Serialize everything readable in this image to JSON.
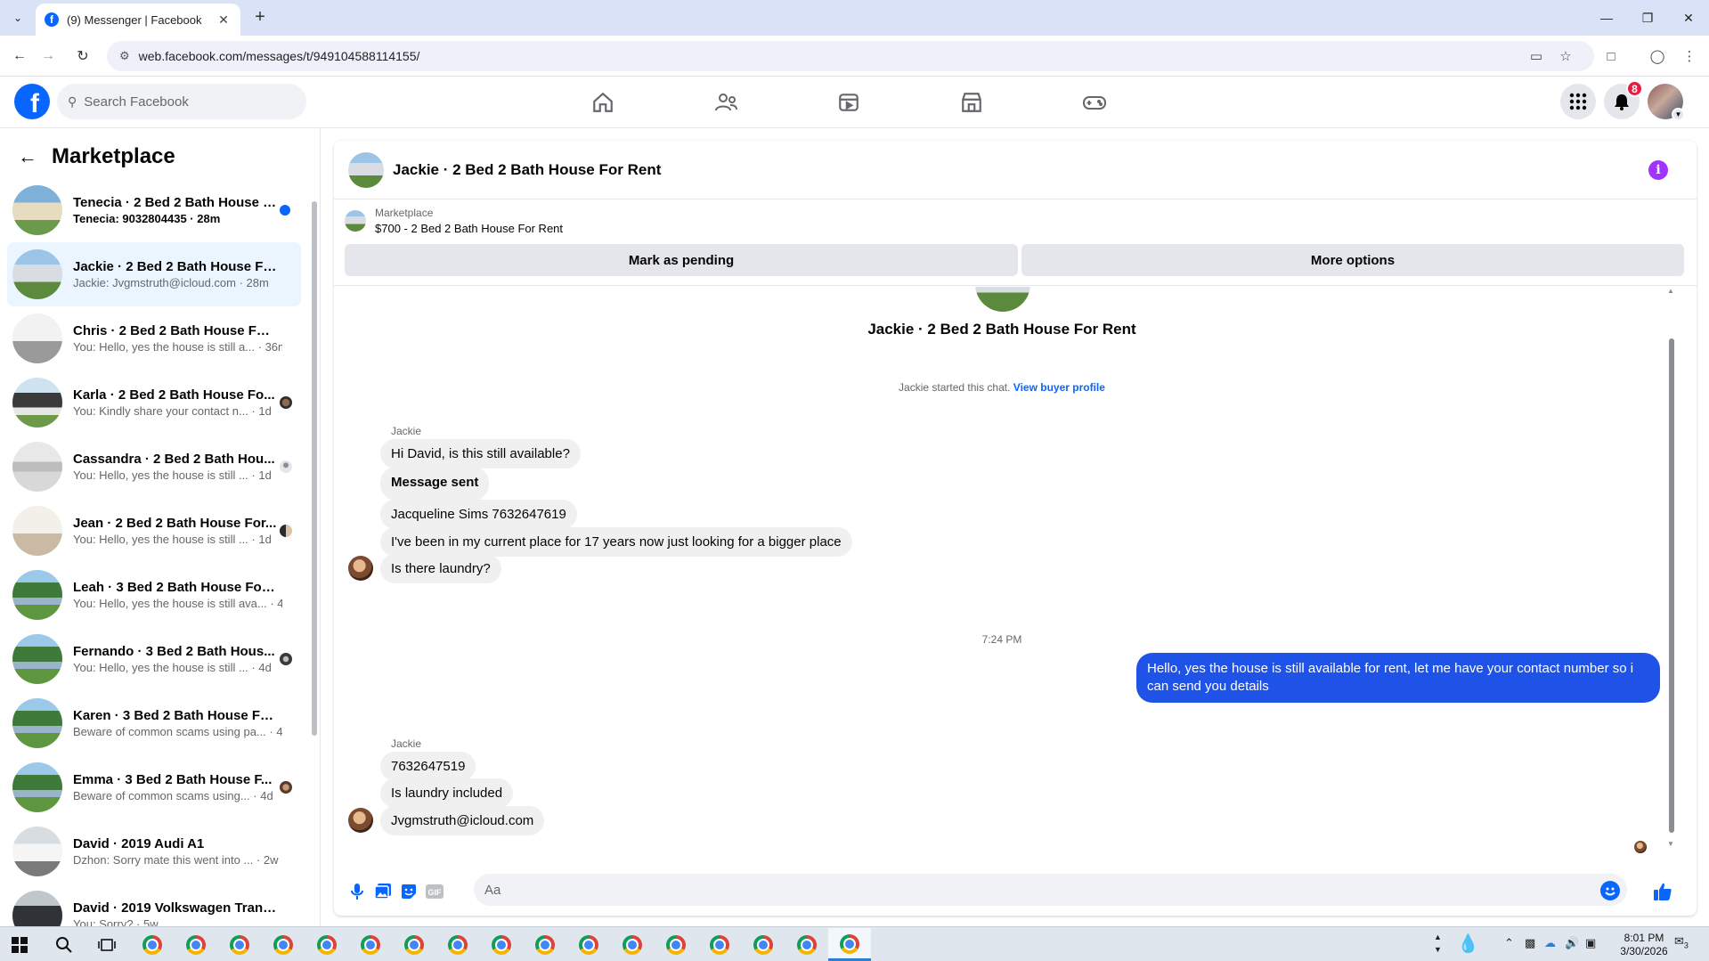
{
  "browser": {
    "tab_title": "(9) Messenger | Facebook",
    "url": "web.facebook.com/messages/t/949104588114155/"
  },
  "fb": {
    "search_placeholder": "Search Facebook",
    "notifications_count": "8"
  },
  "left": {
    "title": "Marketplace",
    "conversations": [
      {
        "name": "Tenecia · 2 Bed 2 Bath House F...",
        "snippet": "Tenecia: 9032804435 · 28m",
        "unread": true,
        "active": false
      },
      {
        "name": "Jackie · 2 Bed 2 Bath House For ...",
        "snippet": "Jackie: Jvgmstruth@icloud.com · 28m",
        "unread": false,
        "active": true
      },
      {
        "name": "Chris · 2 Bed 2 Bath House For R...",
        "snippet": "You: Hello, yes the house is still a... · 36m",
        "unread": false,
        "active": false
      },
      {
        "name": "Karla · 2 Bed 2 Bath House Fo...",
        "snippet": "You: Kindly share your contact n... · 1d",
        "unread": false,
        "active": false
      },
      {
        "name": "Cassandra · 2 Bed 2 Bath Hou...",
        "snippet": "You: Hello, yes the house is still ... · 1d",
        "unread": false,
        "active": false
      },
      {
        "name": "Jean · 2 Bed 2 Bath House For...",
        "snippet": "You: Hello, yes the house is still ... · 1d",
        "unread": false,
        "active": false
      },
      {
        "name": "Leah · 3 Bed 2 Bath House For R...",
        "snippet": "You: Hello, yes the house is still ava... · 4d",
        "unread": false,
        "active": false
      },
      {
        "name": "Fernando · 3 Bed 2 Bath Hous...",
        "snippet": "You: Hello, yes the house is still ... · 4d",
        "unread": false,
        "active": false
      },
      {
        "name": "Karen · 3 Bed 2 Bath House For ...",
        "snippet": "Beware of common scams using pa... · 4d",
        "unread": false,
        "active": false
      },
      {
        "name": "Emma · 3 Bed 2 Bath House F...",
        "snippet": "Beware of common scams using... · 4d",
        "unread": false,
        "active": false
      },
      {
        "name": "David · 2019 Audi A1",
        "snippet": "Dzhon: Sorry mate this went into ... · 2w",
        "unread": false,
        "active": false
      },
      {
        "name": "David · 2019 Volkswagen Transp...",
        "snippet": "You: Sorry? · 5w",
        "unread": false,
        "active": false
      }
    ]
  },
  "chat": {
    "header_title": "Jackie · 2 Bed 2 Bath House For Rent",
    "listing_source": "Marketplace",
    "listing_price_title": "$700 - 2 Bed 2 Bath House For Rent",
    "mark_pending": "Mark as pending",
    "more_options": "More options",
    "center_title": "Jackie · 2 Bed 2 Bath House For Rent",
    "started_text": "Jackie started this chat.",
    "view_profile": "View buyer profile",
    "sender_name": "Jackie",
    "group1": [
      "Hi David, is this still available?",
      "Message sent",
      "Jacqueline Sims 7632647619",
      "I've been in my current place for 17 years now just looking for a bigger place",
      "Is there laundry?"
    ],
    "timestamp": "7:24 PM",
    "outgoing": "Hello, yes the house is still available for rent, let me have your contact number so i can send you  details",
    "group2": [
      "7632647519",
      "Is laundry included",
      "Jvgmstruth@icloud.com"
    ],
    "composer_placeholder": "Aa"
  },
  "taskbar": {
    "time": "8:01 PM",
    "date": "3/30/2026",
    "notif_count": "3"
  }
}
